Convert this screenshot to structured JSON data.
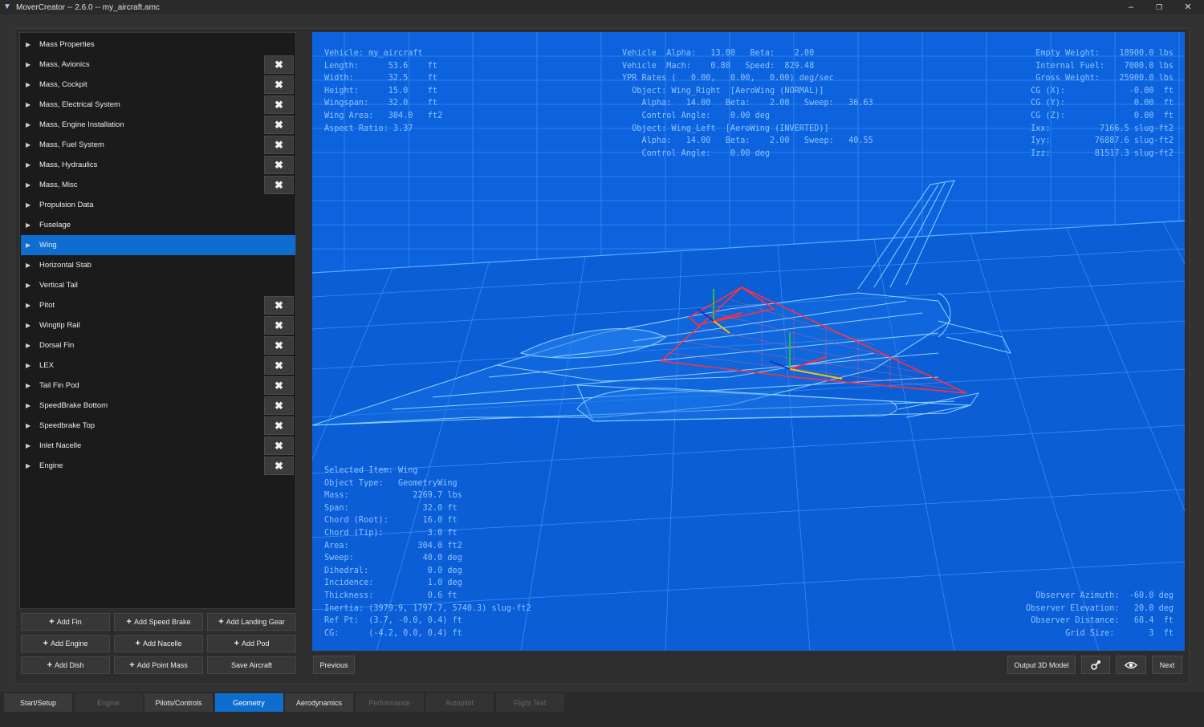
{
  "window": {
    "title": "MoverCreator -- 2.6.0 -- my_aircraft.amc",
    "minimize": "–",
    "restore": "❐",
    "close": "✕"
  },
  "tree": {
    "items": [
      {
        "label": "Mass Properties",
        "deletable": false
      },
      {
        "label": "Mass, Avionics",
        "deletable": true
      },
      {
        "label": "Mass, Cockpit",
        "deletable": true
      },
      {
        "label": "Mass, Electrical System",
        "deletable": true
      },
      {
        "label": "Mass, Engine Installation",
        "deletable": true
      },
      {
        "label": "Mass, Fuel System",
        "deletable": true
      },
      {
        "label": "Mass, Hydraulics",
        "deletable": true
      },
      {
        "label": "Mass, Misc",
        "deletable": true
      },
      {
        "label": "Propulsion Data",
        "deletable": false
      },
      {
        "label": "Fuselage",
        "deletable": false
      },
      {
        "label": "Wing",
        "deletable": false,
        "selected": true
      },
      {
        "label": "Horizontal Stab",
        "deletable": false
      },
      {
        "label": "Vertical Tail",
        "deletable": false
      },
      {
        "label": "Pitot",
        "deletable": true
      },
      {
        "label": "Wingtip Rail",
        "deletable": true
      },
      {
        "label": "Dorsal Fin",
        "deletable": true
      },
      {
        "label": "LEX",
        "deletable": true
      },
      {
        "label": "Tail Fin Pod",
        "deletable": true
      },
      {
        "label": "SpeedBrake Bottom",
        "deletable": true
      },
      {
        "label": "Speedbrake Top",
        "deletable": true
      },
      {
        "label": "Inlet Nacelle",
        "deletable": true
      },
      {
        "label": "Engine",
        "deletable": true
      }
    ],
    "delete_icon": "✖",
    "arrow_icon": "▶"
  },
  "actions": {
    "add_fin": "Add Fin",
    "add_speed_brake": "Add Speed Brake",
    "add_landing_gear": "Add Landing Gear",
    "add_engine": "Add Engine",
    "add_nacelle": "Add Nacelle",
    "add_pod": "Add Pod",
    "add_dish": "Add Dish",
    "add_point_mass": "Add Point Mass",
    "save_aircraft": "Save Aircraft",
    "plus_icon": "+"
  },
  "hud": {
    "vehicle_info": "Vehicle: my_aircraft\nLength:      53.6    ft\nWidth:       32.5    ft\nHeight:      15.0    ft\nWingspan:    32.0    ft\nWing Area:   304.0   ft2\nAspect Ratio: 3.37",
    "aero_info": "Vehicle  Alpha:   13.00   Beta:    2.00\nVehicle  Mach:    0.80   Speed:  829.48\nYPR Rates (   0.00,   0.00,   0.00) deg/sec\n  Object: Wing_Right  [AeroWing (NORMAL)]\n    Alpha:   14.00   Beta:    2.00   Sweep:   36.63\n    Control Angle:    0.00 deg\n  Object: Wing_Left  [AeroWing (INVERTED)]\n    Alpha:   14.00   Beta:    2.00   Sweep:   40.55\n    Control Angle:    0.00 deg",
    "mass_info": "Empty Weight:    18900.0 lbs\nInternal Fuel:    7000.0 lbs\nGross Weight:    25900.0 lbs\nCG (X):             -0.00  ft\nCG (Y):              0.00  ft\nCG (Z):              0.00  ft\nIxx:          7166.5 slug-ft2\nIyy:         76887.6 slug-ft2\nIzz:         81517.3 slug-ft2",
    "selected_info": "Selected Item: Wing\nObject Type:   GeometryWing\nMass:             2269.7 lbs\nSpan:               32.0 ft\nChord (Root):       16.0 ft\nChord (Tip):         3.0 ft\nArea:              304.0 ft2\nSweep:              40.0 deg\nDihedral:            0.0 deg\nIncidence:           1.0 deg\nThickness:           0.6 ft\nInertia: (3979.9, 1797.7, 5740.3) slug-ft2\nRef Pt:  (3.7, -0.0, 0.4) ft\nCG:      (-4.2, 0.0, 0.4) ft",
    "observer_info": "Observer Azimuth:  -60.0 deg\nObserver Elevation:   20.0 deg\nObserver Distance:   68.4  ft\nGrid Size:       3  ft"
  },
  "viewport_nav": {
    "previous": "Previous",
    "output_3d_model": "Output 3D Model",
    "next": "Next",
    "tool_icon": "wrench-gear-icon",
    "eye_icon": "eye-icon"
  },
  "tabs": [
    {
      "label": "Start/Setup",
      "state": "normal"
    },
    {
      "label": "Engine",
      "state": "disabled"
    },
    {
      "label": "Pilots/Controls",
      "state": "normal"
    },
    {
      "label": "Geometry",
      "state": "active"
    },
    {
      "label": "Aerodynamics",
      "state": "normal"
    },
    {
      "label": "Performance",
      "state": "disabled"
    },
    {
      "label": "Autopilot",
      "state": "disabled"
    },
    {
      "label": "Flight Test",
      "state": "disabled"
    }
  ],
  "colors": {
    "accent": "#0d6ed0",
    "viewport_bg": "#0b5ed6",
    "wireframe": "#7fc3ff",
    "selected_wing": "#ff2d3a",
    "hud_text": "#8fc2ff"
  }
}
